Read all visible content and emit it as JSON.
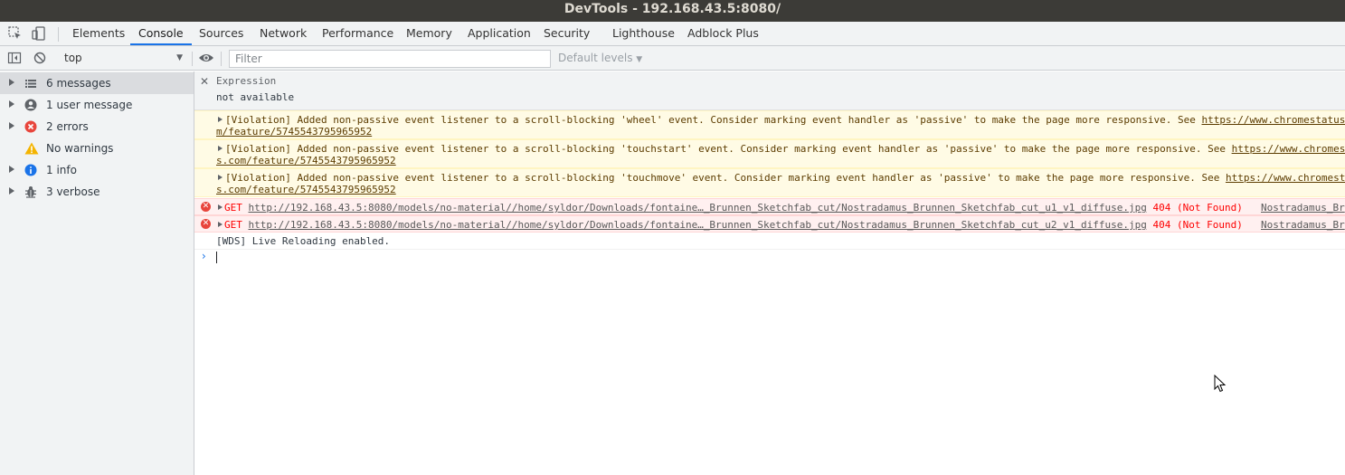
{
  "window": {
    "title": "DevTools - 192.168.43.5:8080/"
  },
  "tabs": [
    "Elements",
    "Console",
    "Sources",
    "Network",
    "Performance",
    "Memory",
    "Application",
    "Security",
    "Lighthouse",
    "Adblock Plus"
  ],
  "active_tab": "Console",
  "toolbar": {
    "context": "top",
    "filter_placeholder": "Filter",
    "levels": "Default levels"
  },
  "sidebar": {
    "items": [
      {
        "label": "6 messages",
        "icon": "list-icon",
        "expandable": true,
        "selected": true
      },
      {
        "label": "1 user message",
        "icon": "user-icon",
        "expandable": true,
        "selected": false
      },
      {
        "label": "2 errors",
        "icon": "error-icon",
        "expandable": true,
        "selected": false
      },
      {
        "label": "No warnings",
        "icon": "warning-icon",
        "expandable": false,
        "selected": false
      },
      {
        "label": "1 info",
        "icon": "info-icon",
        "expandable": true,
        "selected": false
      },
      {
        "label": "3 verbose",
        "icon": "bug-icon",
        "expandable": true,
        "selected": false
      }
    ]
  },
  "expression": {
    "label": "Expression",
    "value": "not available"
  },
  "messages": {
    "warnings": [
      {
        "text": "[Violation] Added non-passive event listener to a scroll-blocking 'wheel' event. Consider marking event handler as 'passive' to make the page more responsive. See ",
        "link_start": "https://www.chromestatus",
        "link_end": "m/feature/5745543795965952"
      },
      {
        "text": "[Violation] Added non-passive event listener to a scroll-blocking 'touchstart' event. Consider marking event handler as 'passive' to make the page more responsive. See ",
        "link_start": "https://www.chromes",
        "link_end": "s.com/feature/5745543795965952"
      },
      {
        "text": "[Violation] Added non-passive event listener to a scroll-blocking 'touchmove' event. Consider marking event handler as 'passive' to make the page more responsive. See ",
        "link_start": "https://www.chromest",
        "link_end": "s.com/feature/5745543795965952"
      }
    ],
    "errors": [
      {
        "method": "GET",
        "url": "http://192.168.43.5:8080/models/no-material//home/syldor/Downloads/fontaine…_Brunnen_Sketchfab_cut/Nostradamus_Brunnen_Sketchfab_cut_u1_v1_diffuse.jpg",
        "status": "404 (Not Found)",
        "source": "Nostradamus_Br"
      },
      {
        "method": "GET",
        "url": "http://192.168.43.5:8080/models/no-material//home/syldor/Downloads/fontaine…_Brunnen_Sketchfab_cut/Nostradamus_Brunnen_Sketchfab_cut_u2_v1_diffuse.jpg",
        "status": "404 (Not Found)",
        "source": "Nostradamus_Br"
      }
    ],
    "log": "[WDS] Live Reloading enabled."
  },
  "colors": {
    "accent": "#1a73e8",
    "error": "#e8453c",
    "warning_bg": "#fffbe5",
    "error_bg": "#fff0f0"
  }
}
